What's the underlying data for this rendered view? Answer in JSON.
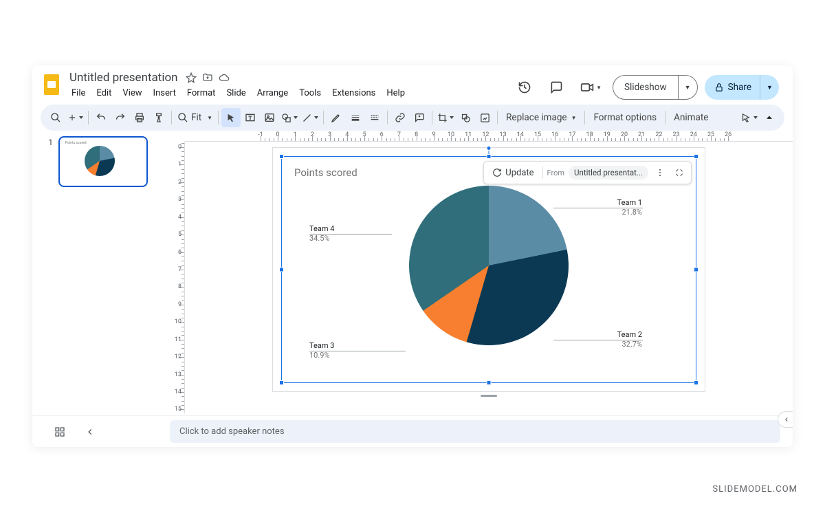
{
  "doc_title": "Untitled presentation",
  "menu": [
    "File",
    "Edit",
    "View",
    "Insert",
    "Format",
    "Slide",
    "Arrange",
    "Tools",
    "Extensions",
    "Help"
  ],
  "header_buttons": {
    "slideshow": "Slideshow",
    "share": "Share"
  },
  "toolbar": {
    "zoom": "Fit",
    "replace_image": "Replace image",
    "format_options": "Format options",
    "animate": "Animate"
  },
  "thumb_number": "1",
  "slide": {
    "chart_title": "Points scored"
  },
  "chart_toolbar": {
    "update": "Update",
    "from": "From",
    "source": "Untitled presentat..."
  },
  "speaker_notes_placeholder": "Click to add speaker notes",
  "watermark": "SLIDEMODEL.COM",
  "chart_data": {
    "type": "pie",
    "title": "Points scored",
    "series": [
      {
        "name": "Team 1",
        "value": 21.8,
        "color": "#5b8ca5"
      },
      {
        "name": "Team 2",
        "value": 32.7,
        "color": "#0b3954"
      },
      {
        "name": "Team 3",
        "value": 10.9,
        "color": "#f77f2f"
      },
      {
        "name": "Team 4",
        "value": 34.5,
        "color": "#2f6e7a"
      }
    ],
    "labels": [
      "Team 1",
      "Team 2",
      "Team 3",
      "Team 4"
    ],
    "values_display": [
      "21.8%",
      "32.7%",
      "10.9%",
      "34.5%"
    ]
  },
  "ruler_h_range": [
    -1,
    26
  ],
  "ruler_v_range": [
    -1,
    15
  ]
}
